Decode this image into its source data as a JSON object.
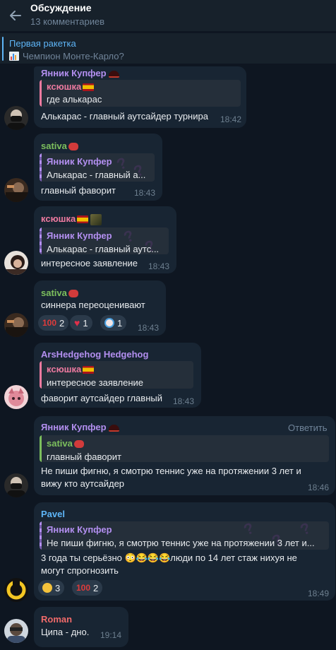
{
  "header": {
    "title": "Обсуждение",
    "subtitle": "13 комментариев"
  },
  "pinned": {
    "title": "Первая ракетка",
    "text": "Чемпион Монте-Карло?"
  },
  "colors": {
    "background": "#0e1621",
    "bubble": "#182533",
    "name_purple": "#b38ff0",
    "name_green": "#7cbf5d",
    "name_pink": "#ee7aa0",
    "name_blue": "#5eb5f7",
    "name_red": "#f06a6a"
  },
  "messages": [
    {
      "author": "Янник Купфер",
      "reply": {
        "author": "ксюшка",
        "text": "где алькарас"
      },
      "text": "Алькарас - главный аутсайдер турнира",
      "time": "18:42"
    },
    {
      "author": "sativa",
      "reply": {
        "author": "Янник Купфер",
        "text": "Алькарас - главный а..."
      },
      "text": "главный фаворит",
      "time": "18:43"
    },
    {
      "author": "ксюшка",
      "reply": {
        "author": "Янник Купфер",
        "text": "Алькарас - главный аутс..."
      },
      "text": "интересное заявление",
      "time": "18:43"
    },
    {
      "author": "sativa",
      "text": "синнера переоценивают",
      "time": "18:43",
      "reactions": [
        {
          "icon": "hundred-emoji",
          "count": "2"
        },
        {
          "icon": "heart-emoji",
          "count": "1"
        },
        {
          "icon": "clown-emoji",
          "count": "1"
        }
      ]
    },
    {
      "author": "ArsHedgehog Hedgehog",
      "reply": {
        "author": "ксюшка",
        "text": "интересное заявление"
      },
      "text": "фаворит аутсайдер главный",
      "time": "18:43"
    },
    {
      "author": "Янник Купфер",
      "reply_button": "Ответить",
      "reply": {
        "author": "sativa",
        "text": "главный фаворит"
      },
      "text_line1": "Не пиши фигню, я смотрю теннис уже на протяжении 3 лет и",
      "text_line2": "вижу кто аутсайдер",
      "time": "18:46"
    },
    {
      "author": "Pavel",
      "reply": {
        "author": "Янник Купфер",
        "text": "Не пиши фигню, я смотрю теннис уже на протяжении 3 лет и..."
      },
      "text_line1": "3 года ты серьёзно 😳😂😂😂люди по 14 лет стаж нихуя не",
      "text_line2": "могут спрогнозить",
      "time": "18:49",
      "reactions": [
        {
          "icon": "grimace-emoji",
          "count": "3"
        },
        {
          "icon": "hundred-emoji",
          "count": "2"
        }
      ]
    },
    {
      "author": "Roman",
      "text": "Ципа - дно.",
      "time": "19:14"
    }
  ]
}
